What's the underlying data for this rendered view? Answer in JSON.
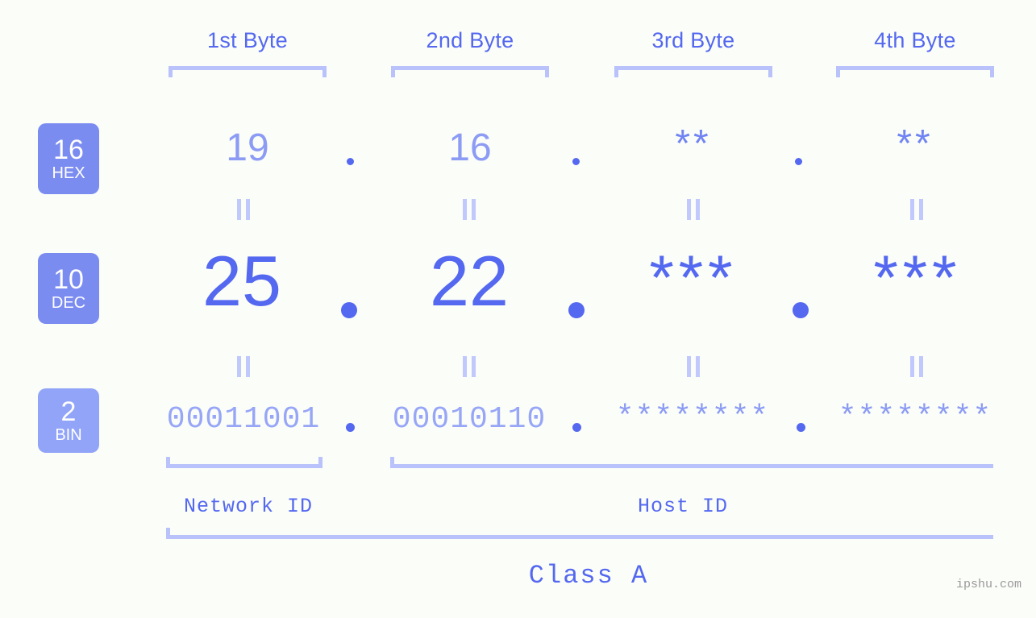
{
  "background_color": "#fbfdf9",
  "accent_color": "#5468f0",
  "accent_light_color": "#b9c2fb",
  "badge_color": "#7b8cf0",
  "headers": [
    {
      "label": "1st Byte"
    },
    {
      "label": "2nd Byte"
    },
    {
      "label": "3rd Byte"
    },
    {
      "label": "4th Byte"
    }
  ],
  "radix_rows": [
    {
      "number": "16",
      "name": "HEX",
      "values": [
        "19",
        "16",
        "**",
        "**"
      ]
    },
    {
      "number": "10",
      "name": "DEC",
      "values": [
        "25",
        "22",
        "***",
        "***"
      ]
    },
    {
      "number": "2",
      "name": "BIN",
      "values": [
        "00011001",
        "00010110",
        "********",
        "********"
      ]
    }
  ],
  "separators": {
    "dot": "·",
    "equals": "="
  },
  "sections": {
    "network_id": "Network ID",
    "host_id": "Host ID",
    "class": "Class A"
  },
  "watermark": "ipshu.com"
}
